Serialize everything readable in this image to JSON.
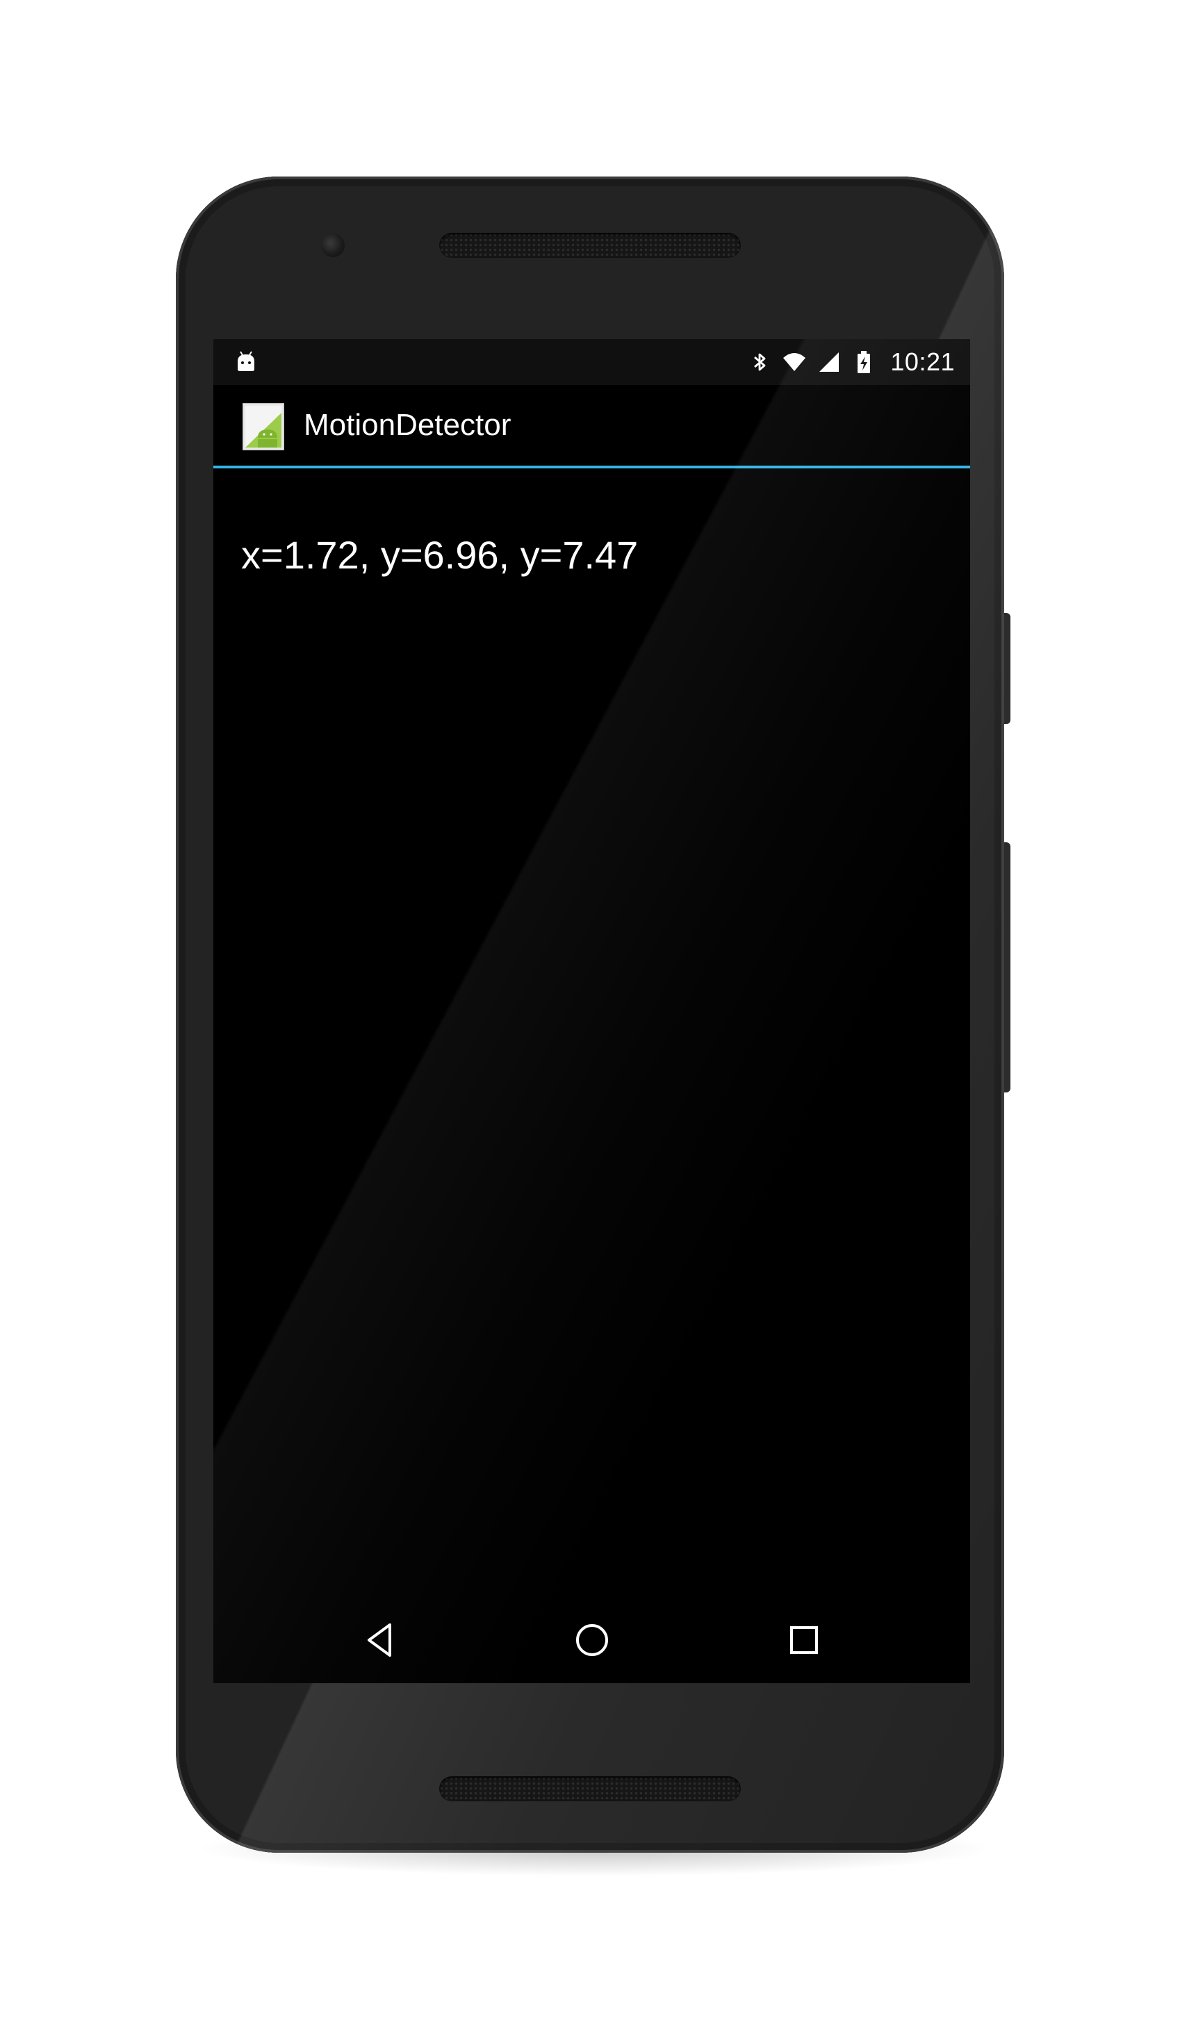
{
  "device": {
    "frame_color": "#232323",
    "screen_color": "#000000"
  },
  "status_bar": {
    "left_icon": "android-debug-icon",
    "icons": [
      "bluetooth-icon",
      "wifi-icon",
      "cell-signal-icon",
      "battery-charging-icon"
    ],
    "time": "10:21"
  },
  "action_bar": {
    "app_icon": "android-app-icon",
    "title": "MotionDetector",
    "divider_color": "#33b5e5"
  },
  "content": {
    "sensor_readout": "x=1.72, y=6.96, y=7.47"
  },
  "nav_bar": {
    "buttons": [
      "back-icon",
      "home-icon",
      "recents-icon"
    ]
  }
}
